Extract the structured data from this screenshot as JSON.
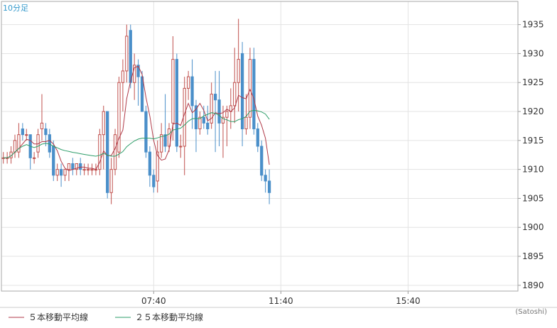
{
  "chart_data": {
    "type": "candlestick",
    "timeframe_label": "10分足",
    "credit": "(Satoshi)",
    "y_ticks": [
      1890,
      1895,
      1900,
      1905,
      1910,
      1915,
      1920,
      1925,
      1930,
      1935
    ],
    "ylim": [
      1889,
      1939
    ],
    "x_ticks": [
      {
        "label": "07:40",
        "index": 39
      },
      {
        "label": "11:40",
        "index": 72
      },
      {
        "label": "15:40",
        "index": 105
      }
    ],
    "n_slots": 134,
    "up_color": "#c0504d",
    "down_color": "#4a8fc9",
    "ma_colors": [
      "#b03a48",
      "#2e9e6a"
    ],
    "legend": [
      {
        "label": "５本移動平均線",
        "color": "#b03a48"
      },
      {
        "label": "２５本移動平均線",
        "color": "#2e9e6a"
      }
    ],
    "ohlc": [
      [
        1912,
        1913,
        1911,
        1912
      ],
      [
        1912,
        1913,
        1911,
        1912
      ],
      [
        1912,
        1914,
        1911,
        1913
      ],
      [
        1913,
        1916,
        1912,
        1915
      ],
      [
        1913,
        1918,
        1912,
        1916
      ],
      [
        1917,
        1918,
        1915,
        1916
      ],
      [
        1916,
        1917,
        1915,
        1916
      ],
      [
        1916,
        1916,
        1910,
        1912
      ],
      [
        1912,
        1913,
        1911,
        1912
      ],
      [
        1913,
        1917,
        1912,
        1916
      ],
      [
        1917,
        1923,
        1915,
        1918
      ],
      [
        1917,
        1918,
        1914,
        1916
      ],
      [
        1916,
        1917,
        1912,
        1913
      ],
      [
        1914,
        1915,
        1908,
        1909
      ],
      [
        1909,
        1911,
        1908,
        1910
      ],
      [
        1910,
        1911,
        1907,
        1909
      ],
      [
        1909,
        1910,
        1908,
        1910
      ],
      [
        1910,
        1911,
        1908,
        1911
      ],
      [
        1911,
        1912,
        1909,
        1910
      ],
      [
        1910,
        1911,
        1909,
        1911
      ],
      [
        1911,
        1912,
        1909,
        1910
      ],
      [
        1910,
        1911,
        1909,
        1910
      ],
      [
        1910,
        1911,
        1909,
        1910
      ],
      [
        1910,
        1911,
        1909,
        1910
      ],
      [
        1910,
        1911,
        1909,
        1910
      ],
      [
        1910,
        1917,
        1909,
        1916
      ],
      [
        1916,
        1921,
        1910,
        1920
      ],
      [
        1920,
        1920,
        1905,
        1906
      ],
      [
        1906,
        1912,
        1904,
        1910
      ],
      [
        1910,
        1917,
        1909,
        1916
      ],
      [
        1913,
        1926,
        1912,
        1925
      ],
      [
        1925,
        1929,
        1920,
        1927
      ],
      [
        1927,
        1935,
        1925,
        1933
      ],
      [
        1934,
        1935,
        1924,
        1925
      ],
      [
        1925,
        1930,
        1922,
        1928
      ],
      [
        1928,
        1929,
        1921,
        1926
      ],
      [
        1926,
        1927,
        1920,
        1920
      ],
      [
        1920,
        1921,
        1912,
        1913
      ],
      [
        1913,
        1914,
        1907,
        1909
      ],
      [
        1909,
        1910,
        1906,
        1907
      ],
      [
        1908,
        1915,
        1906,
        1913
      ],
      [
        1913,
        1918,
        1912,
        1916
      ],
      [
        1916,
        1923,
        1913,
        1914
      ],
      [
        1914,
        1918,
        1913,
        1917
      ],
      [
        1918,
        1933,
        1915,
        1929
      ],
      [
        1929,
        1930,
        1913,
        1914
      ],
      [
        1914,
        1916,
        1912,
        1914
      ],
      [
        1914,
        1926,
        1909,
        1924
      ],
      [
        1924,
        1927,
        1922,
        1926
      ],
      [
        1926,
        1929,
        1917,
        1921
      ],
      [
        1921,
        1922,
        1913,
        1917
      ],
      [
        1917,
        1920,
        1916,
        1919
      ],
      [
        1919,
        1921,
        1917,
        1918
      ],
      [
        1918,
        1921,
        1916,
        1917
      ],
      [
        1918,
        1925,
        1917,
        1923
      ],
      [
        1923,
        1927,
        1913,
        1922
      ],
      [
        1922,
        1927,
        1914,
        1918
      ],
      [
        1918,
        1921,
        1912,
        1919
      ],
      [
        1919,
        1921,
        1914,
        1920
      ],
      [
        1920,
        1924,
        1917,
        1921
      ],
      [
        1921,
        1931,
        1918,
        1925
      ],
      [
        1925,
        1936,
        1920,
        1929
      ],
      [
        1930,
        1932,
        1914,
        1917
      ],
      [
        1917,
        1923,
        1916,
        1919
      ],
      [
        1919,
        1931,
        1917,
        1929
      ],
      [
        1929,
        1931,
        1916,
        1917
      ],
      [
        1917,
        1918,
        1913,
        1914
      ],
      [
        1914,
        1915,
        1908,
        1909
      ],
      [
        1909,
        1910,
        1906,
        1908
      ],
      [
        1908,
        1910,
        1904,
        1906
      ]
    ]
  }
}
